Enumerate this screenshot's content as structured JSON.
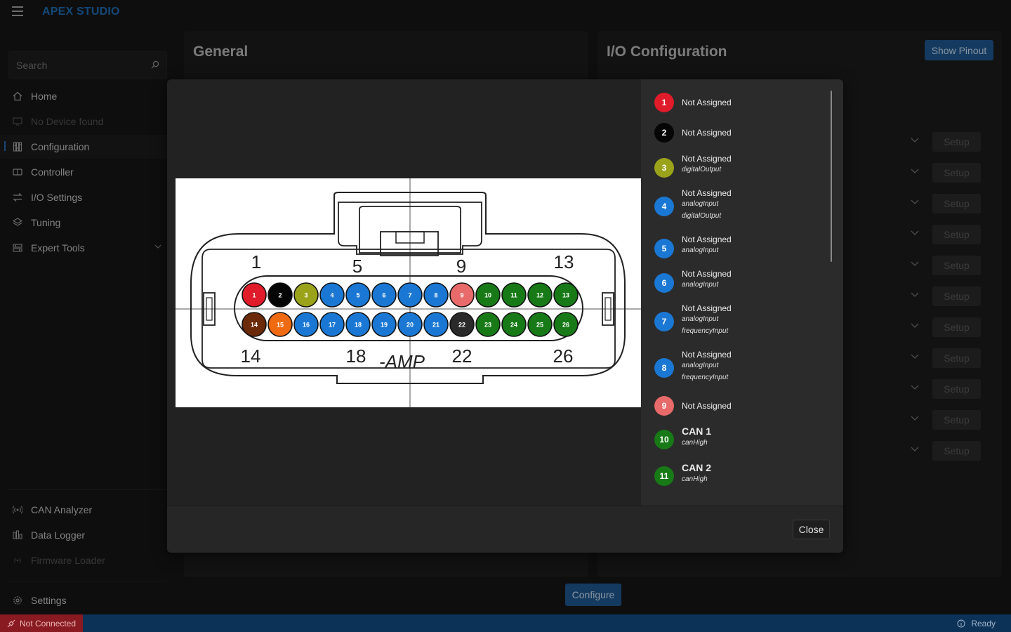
{
  "app": {
    "title": "APEX STUDIO"
  },
  "sidebar": {
    "search_placeholder": "Search",
    "items": [
      {
        "label": "Home",
        "icon": "home-icon",
        "disabled": false
      },
      {
        "label": "No Device found",
        "icon": "device-icon",
        "disabled": true
      },
      {
        "label": "Configuration",
        "icon": "sliders-icon",
        "disabled": false,
        "active": true
      },
      {
        "label": "Controller",
        "icon": "controller-icon",
        "disabled": false
      },
      {
        "label": "I/O Settings",
        "icon": "swap-icon",
        "disabled": false
      },
      {
        "label": "Tuning",
        "icon": "layers-icon",
        "disabled": false
      },
      {
        "label": "Expert Tools",
        "icon": "tools-icon",
        "disabled": false
      }
    ],
    "bottom_items": [
      {
        "label": "CAN Analyzer",
        "icon": "radio-icon",
        "disabled": false
      },
      {
        "label": "Data Logger",
        "icon": "bar-chart-icon",
        "disabled": false
      },
      {
        "label": "Firmware Loader",
        "icon": "radio-icon",
        "disabled": true
      }
    ],
    "settings_label": "Settings"
  },
  "panels": {
    "general_title": "General",
    "io_title": "I/O Configuration",
    "show_pinout_label": "Show Pinout",
    "setup_label": "Setup",
    "configure_label": "Configure"
  },
  "status": {
    "connection": "Not Connected",
    "state": "Ready"
  },
  "modal": {
    "close_label": "Close",
    "pins": [
      {
        "number": "1",
        "color": "#e01b2a",
        "name": "Not Assigned",
        "tags": []
      },
      {
        "number": "2",
        "color": "#050505",
        "name": "Not Assigned",
        "tags": []
      },
      {
        "number": "3",
        "color": "#9aa31a",
        "name": "Not Assigned",
        "tags": [
          "digitalOutput"
        ]
      },
      {
        "number": "4",
        "color": "#1a78d4",
        "name": "Not Assigned",
        "tags": [
          "analogInput",
          "digitalOutput"
        ]
      },
      {
        "number": "5",
        "color": "#1a78d4",
        "name": "Not Assigned",
        "tags": [
          "analogInput"
        ]
      },
      {
        "number": "6",
        "color": "#1a78d4",
        "name": "Not Assigned",
        "tags": [
          "analogInput"
        ]
      },
      {
        "number": "7",
        "color": "#1a78d4",
        "name": "Not Assigned",
        "tags": [
          "analogInput",
          "frequencyInput"
        ]
      },
      {
        "number": "8",
        "color": "#1a78d4",
        "name": "Not Assigned",
        "tags": [
          "analogInput",
          "frequencyInput"
        ]
      },
      {
        "number": "9",
        "color": "#e96a6a",
        "name": "Not Assigned",
        "tags": []
      },
      {
        "number": "10",
        "color": "#177a17",
        "name": "CAN 1",
        "tags": [
          "canHigh"
        ]
      },
      {
        "number": "11",
        "color": "#177a17",
        "name": "CAN 2",
        "tags": [
          "canHigh"
        ]
      }
    ]
  },
  "connector": {
    "top_labels": [
      "1",
      "5",
      "9",
      "13"
    ],
    "bottom_labels": [
      "14",
      "18",
      "22",
      "26"
    ],
    "brand": "-AMP",
    "row1": [
      {
        "n": "1",
        "c": "#e01b2a"
      },
      {
        "n": "2",
        "c": "#050505"
      },
      {
        "n": "3",
        "c": "#9aa31a"
      },
      {
        "n": "4",
        "c": "#1a78d4"
      },
      {
        "n": "5",
        "c": "#1a78d4"
      },
      {
        "n": "6",
        "c": "#1a78d4"
      },
      {
        "n": "7",
        "c": "#1a78d4"
      },
      {
        "n": "8",
        "c": "#1a78d4"
      },
      {
        "n": "9",
        "c": "#e96a6a"
      },
      {
        "n": "10",
        "c": "#177a17"
      },
      {
        "n": "11",
        "c": "#177a17"
      },
      {
        "n": "12",
        "c": "#177a17"
      },
      {
        "n": "13",
        "c": "#177a17"
      }
    ],
    "row2": [
      {
        "n": "14",
        "c": "#6b2a0a"
      },
      {
        "n": "15",
        "c": "#ef6a10"
      },
      {
        "n": "16",
        "c": "#1a78d4"
      },
      {
        "n": "17",
        "c": "#1a78d4"
      },
      {
        "n": "18",
        "c": "#1a78d4"
      },
      {
        "n": "19",
        "c": "#1a78d4"
      },
      {
        "n": "20",
        "c": "#1a78d4"
      },
      {
        "n": "21",
        "c": "#1a78d4"
      },
      {
        "n": "22",
        "c": "#2a2a2a"
      },
      {
        "n": "23",
        "c": "#177a17"
      },
      {
        "n": "24",
        "c": "#177a17"
      },
      {
        "n": "25",
        "c": "#177a17"
      },
      {
        "n": "26",
        "c": "#177a17"
      }
    ]
  }
}
